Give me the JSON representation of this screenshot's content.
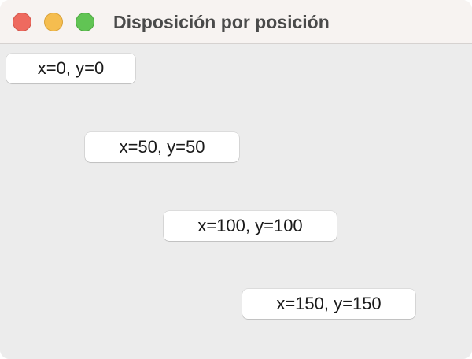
{
  "window": {
    "title": "Disposición por posición",
    "controls": {
      "close": "close-icon",
      "minimize": "minimize-icon",
      "zoom": "zoom-icon"
    },
    "colors": {
      "close": "#ee6a5f",
      "minimize": "#f5bd4f",
      "zoom": "#61c454",
      "titlebar": "#f7f3f1",
      "content": "#ececec"
    }
  },
  "buttons": [
    {
      "label": "x=0, y=0"
    },
    {
      "label": "x=50, y=50"
    },
    {
      "label": "x=100, y=100"
    },
    {
      "label": "x=150, y=150"
    }
  ]
}
